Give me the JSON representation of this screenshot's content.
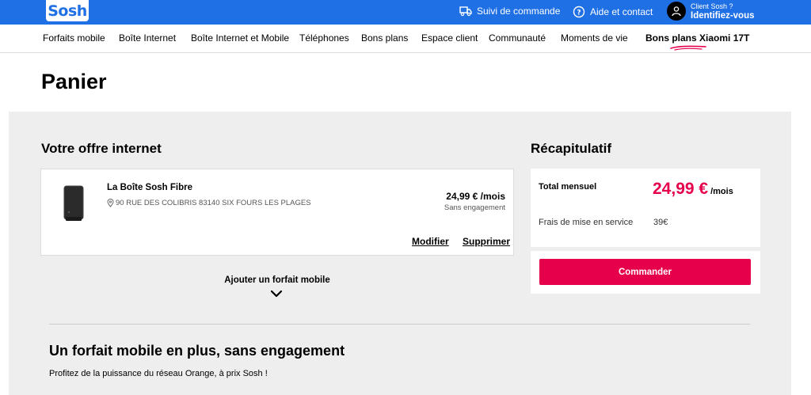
{
  "header": {
    "logo": "Sosh",
    "suivi": "Suivi de commande",
    "aide": "Aide et contact",
    "account_small": "Client Sosh ?",
    "account_big": "Identifiez-vous"
  },
  "nav": {
    "items": [
      "Forfaits mobile",
      "Boîte Internet",
      "Boîte Internet et Mobile",
      "Téléphones",
      "Bons plans",
      "Espace client",
      "Communauté",
      "Moments de vie",
      "Bons plans Xiaomi 17T"
    ]
  },
  "page": {
    "title": "Panier"
  },
  "offer": {
    "section_title": "Votre offre internet",
    "name": "La Boîte Sosh Fibre",
    "address": "90 RUE DES COLIBRIS 83140 SIX FOURS LES PLAGES",
    "price": "24,99 € /mois",
    "engagement": "Sans engagement",
    "modify": "Modifier",
    "delete": "Supprimer",
    "add_mobile": "Ajouter un forfait mobile"
  },
  "recap": {
    "section_title": "Récapitulatif",
    "total_label": "Total mensuel",
    "total_value": "24,99 €",
    "total_period": "/mois",
    "fees_label": "Frais de mise en service",
    "fees_value": "39€",
    "order_button": "Commander"
  },
  "promo": {
    "title": "Un forfait mobile en plus, sans engagement",
    "subtitle": "Profitez de la puissance du réseau Orange, à prix Sosh !"
  },
  "colors": {
    "brand_blue": "#1f6fe5",
    "accent_pink": "#e6004c"
  }
}
